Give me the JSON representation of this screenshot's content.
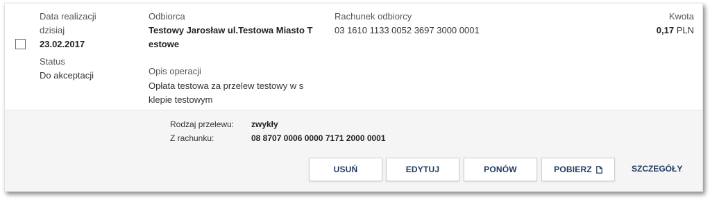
{
  "row": {
    "date_label": "Data realizacji",
    "date_relative": "dzisiaj",
    "date_value": "23.02.2017",
    "status_label": "Status",
    "status_value": "Do akceptacji",
    "recipient_label": "Odbiorca",
    "recipient_line1": "Testowy Jarosław ul.Testowa Miasto T",
    "recipient_line2": "estowe",
    "description_label": "Opis operacji",
    "description_line1": "Opłata testowa za przelew testowy w s",
    "description_line2": "klepie testowym",
    "account_label": "Rachunek odbiorcy",
    "account_value": "03 1610 1133 0052 3697 3000 0001",
    "amount_label": "Kwota",
    "amount_value": "0,17",
    "amount_currency": "PLN"
  },
  "details": {
    "transfer_type_label": "Rodzaj przelewu:",
    "transfer_type_value": "zwykły",
    "from_account_label": "Z rachunku:",
    "from_account_value": "08 8707 0006 0000 7171 2000 0001"
  },
  "actions": {
    "delete": "USUŃ",
    "edit": "EDYTUJ",
    "repeat": "PONÓW",
    "download": "POBIERZ",
    "details": "SZCZEGÓŁY"
  },
  "icons": {
    "download": "document-icon"
  },
  "colors": {
    "button_text": "#1e3a5f",
    "details_background": "#f5f5f5"
  }
}
